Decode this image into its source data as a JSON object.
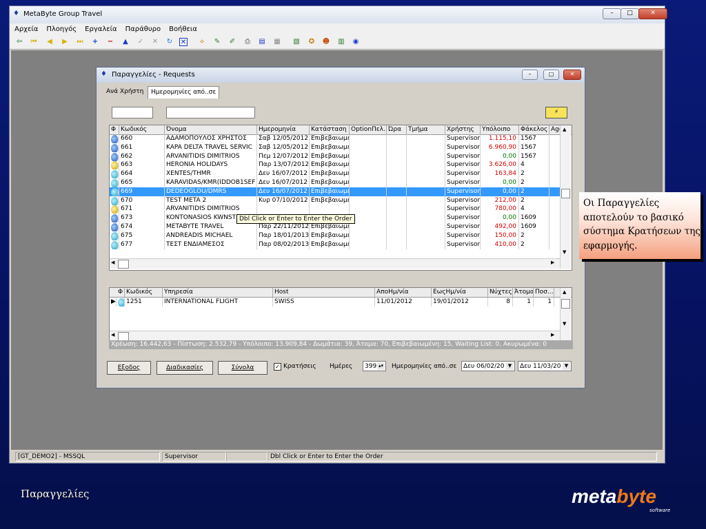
{
  "app": {
    "title": "MetaByte Group Travel",
    "menu": [
      "Αρχεία",
      "Πλοηγός",
      "Εργαλεία",
      "Παράθυρο",
      "Βοήθεια"
    ]
  },
  "dialog": {
    "title": "Παραγγελίες - Requests",
    "tabs": [
      "Ανά Χρήστη",
      "Ημερομηνίες από..σε"
    ],
    "upper_columns": [
      "Φ",
      "Κωδικός",
      "Όνομα",
      "Ημερομηνία",
      "Κατάσταση",
      "OptionΠελ..",
      "Ώρα",
      "Τμήμα",
      "Χρήστης",
      "Υπόλοιπο",
      "Φάκελος",
      "Age"
    ],
    "upper_rows": [
      {
        "icon": "b",
        "code": "660",
        "name": "ΑΔΑΜΟΠΟΥΛΟΣ ΧΡΗΣΤΟΣ",
        "date": "Σαβ 12/05/2012",
        "status": "Επιβεβαιωμέ",
        "user": "Supervisor",
        "balance": "1.115,10",
        "bal_color": "neg",
        "folder": "1567"
      },
      {
        "icon": "b",
        "code": "661",
        "name": "KAPA DELTA TRAVEL SERVIC",
        "date": "Σαβ 12/05/2012",
        "status": "Επιβεβαιωμέ",
        "user": "Supervisor",
        "balance": "6.960,90",
        "bal_color": "neg",
        "folder": "1567"
      },
      {
        "icon": "b",
        "code": "662",
        "name": "ARVANITIDIS DIMITRIOS",
        "date": "Πεμ 12/07/2012",
        "status": "Επιβεβαιωμέ",
        "user": "Supervisor",
        "balance": "0,00",
        "bal_color": "pos",
        "folder": "1567"
      },
      {
        "icon": "y",
        "code": "663",
        "name": "HERONIA HOLIDAYS",
        "date": "Παρ 13/07/2012",
        "status": "Επιβεβαιωμέ",
        "user": "Supervisor",
        "balance": "3.626,00",
        "bal_color": "neg",
        "folder": "4"
      },
      {
        "icon": "c",
        "code": "664",
        "name": "XENTES/THMR",
        "date": "Δευ 16/07/2012",
        "status": "Επιβεβαιωμέ",
        "user": "Supervisor",
        "balance": "163,84",
        "bal_color": "neg",
        "folder": "2"
      },
      {
        "icon": "c",
        "code": "665",
        "name": "KARAVIDAS/KMR(IDDOB1SEF",
        "date": "Δευ 16/07/2012",
        "status": "Επιβεβαιωμέ",
        "user": "Supervisor",
        "balance": "0,00",
        "bal_color": "pos",
        "folder": "2"
      },
      {
        "icon": "c",
        "code": "669",
        "name": "DEDEOGLOU/DMRS",
        "date": "Δευ 16/07/2012",
        "status": "Επιβεβαιωμέ",
        "user": "Supervisor",
        "balance": "0,00",
        "bal_color": "pos",
        "folder": "2",
        "selected": true
      },
      {
        "icon": "c",
        "code": "670",
        "name": "TEST META 2",
        "date": "Κυρ 07/10/2012",
        "status": "Επιβεβαιωμέ",
        "user": "Supervisor",
        "balance": "212,00",
        "bal_color": "neg",
        "folder": "2"
      },
      {
        "icon": "y",
        "code": "671",
        "name": "ARVANITIDIS DIMITRIOS",
        "date": "",
        "status": "",
        "user": "Supervisor",
        "balance": "780,00",
        "bal_color": "neg",
        "folder": "4"
      },
      {
        "icon": "b",
        "code": "673",
        "name": "KONTONASIOS KWNST",
        "date": "",
        "status": "",
        "user": "Supervisor",
        "balance": "0,00",
        "bal_color": "pos",
        "folder": "1609"
      },
      {
        "icon": "b",
        "code": "674",
        "name": "METABYTE TRAVEL",
        "date": "Παρ 22/11/2012",
        "status": "Επιβεβαιωμέ",
        "user": "Supervisor",
        "balance": "492,00",
        "bal_color": "neg",
        "folder": "1609"
      },
      {
        "icon": "c",
        "code": "675",
        "name": "ANDREADIS MICHAEL",
        "date": "Παρ 18/01/2013",
        "status": "Επιβεβαιωμέ",
        "user": "Supervisor",
        "balance": "150,00",
        "bal_color": "neg",
        "folder": "2"
      },
      {
        "icon": "c",
        "code": "677",
        "name": "ΤΕΣΤ ΕΝΔΙΑΜΕΣΟΣ",
        "date": "Παρ 08/02/2013",
        "status": "Επιβεβαιωμέ",
        "user": "Supervisor",
        "balance": "410,00",
        "bal_color": "neg",
        "folder": "2"
      }
    ],
    "tooltip": "Dbl Click or Enter to Enter the Order",
    "lower_columns": [
      "Φ",
      "Κωδικός",
      "Υπηρεσία",
      "Host",
      "ΑποΗμ/νία",
      "ΕωςΗμ/νία",
      "Νύχτες",
      "Άτομα",
      "Ποσ..."
    ],
    "lower_rows": [
      {
        "code": "1251",
        "service": "INTERNATIONAL FLIGHT",
        "host": "SWISS",
        "from": "11/01/2012",
        "to": "19/01/2012",
        "nights": "8",
        "persons": "1",
        "qty": "1"
      }
    ],
    "summary": "Χρέωση: 16.442,63  - Πίστωση: 2.532,79  - Υπόλοιπο: 13.909,84  - Δωμάτια: 39,   Άτομα: 70,   Επιβεβαιωμένη: 15,   Waiting List: 0,   Ακυρωμένα: 0",
    "buttons": {
      "exit": "Εξοδος",
      "procedures": "Διαδικασίες",
      "totals": "Σύνολα"
    },
    "reservations_label": "Κρατήσεις",
    "days_label": "Ημέρες",
    "days_value": "399",
    "date_range_label": "Ημερομηνίες από..σε",
    "date_from": "Δευ 06/02/20",
    "date_to": "Δευ 11/03/20"
  },
  "status_bar": {
    "db": "[GT_DEMO2] - MSSQL",
    "user": "Supervisor",
    "hint": "Dbl Click or Enter to Enter the Order"
  },
  "callout": "Οι Παραγγελίες αποτελούν το βασικό σύστημα Κρατήσεων της εφαρμογής.",
  "slide_title": "Παραγγελίες",
  "logo": {
    "part1": "meta",
    "part2": "byte",
    "sub": "software"
  }
}
